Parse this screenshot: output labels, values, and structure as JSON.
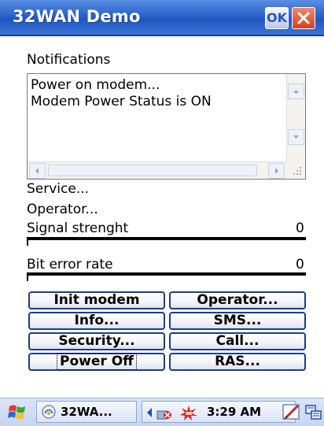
{
  "window": {
    "title": "32WAN Demo",
    "ok_label": "OK",
    "title_bar_color": "#2a62cc"
  },
  "notifications": {
    "label": "Notifications",
    "lines": [
      "Power on modem...",
      "Modem Power Status is ON"
    ]
  },
  "status": {
    "service_label": "Service...",
    "operator_label": "Operator...",
    "signal_label": "Signal strenght",
    "signal_value": "0",
    "signal_fraction": 0,
    "ber_label": "Bit error rate",
    "ber_value": "0",
    "ber_fraction": 0
  },
  "buttons": {
    "init_modem": "Init modem",
    "operator": "Operator...",
    "info": "Info...",
    "sms": "SMS...",
    "security": "Security...",
    "call": "Call...",
    "power_off": "Power Off",
    "ras": "RAS..."
  },
  "taskbar": {
    "app_label": "32WA...",
    "time": "3:29 AM",
    "icons": [
      "start-flag-icon",
      "app-icon",
      "back-arrow-icon",
      "network-icon",
      "modem-icon",
      "pen-input-icon",
      "keyboard-icon"
    ]
  }
}
